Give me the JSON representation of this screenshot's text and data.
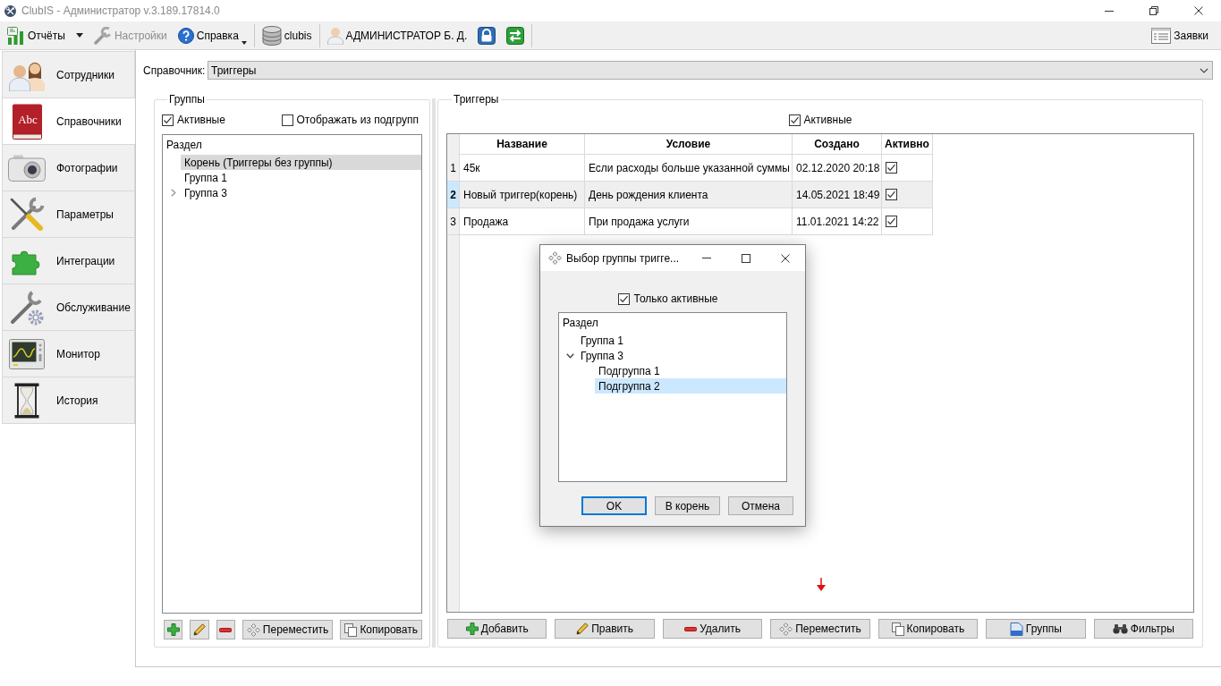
{
  "window": {
    "title": "ClubIS - Администратор v.3.189.17814.0"
  },
  "toolbar": {
    "groups": [
      [
        {
          "kind": "reports",
          "label": "Отчёты",
          "disabled": false
        },
        {
          "kind": "dropdown"
        },
        {
          "kind": "settings",
          "label": "Настройки",
          "disabled": true
        },
        {
          "kind": "help",
          "label": "Справка",
          "disabled": false
        }
      ],
      [
        {
          "kind": "database",
          "label": "clubis",
          "disabled": false
        }
      ],
      [
        {
          "kind": "user",
          "label": "АДМИНИСТРАТОР Б. Д.",
          "disabled": false
        },
        {
          "kind": "lock"
        },
        {
          "kind": "exit"
        }
      ]
    ],
    "requests": {
      "label": "Заявки"
    }
  },
  "sidebar": {
    "items": [
      {
        "label": "Сотрудники",
        "selected": false
      },
      {
        "label": "Справочники",
        "selected": true,
        "icon_text": "Abc"
      },
      {
        "label": "Фотографии",
        "selected": false
      },
      {
        "label": "Параметры",
        "selected": false
      },
      {
        "label": "Интеграции",
        "selected": false
      },
      {
        "label": "Обслуживание",
        "selected": false
      },
      {
        "label": "Монитор",
        "selected": false
      },
      {
        "label": "История",
        "selected": false
      }
    ]
  },
  "directory": {
    "label": "Справочник:",
    "value": "Триггеры"
  },
  "groups": {
    "title": "Группы",
    "active_only": {
      "label": "Активные",
      "checked": true
    },
    "show_subgroups": {
      "label": "Отображать из подгрупп",
      "checked": false
    },
    "tree": {
      "header": "Раздел",
      "items": [
        {
          "label": "Корень (Триггеры без группы)",
          "selected": true
        },
        {
          "label": "Группа 1",
          "selected": false
        },
        {
          "label": "Группа 3",
          "selected": false,
          "expanded": false
        }
      ]
    },
    "buttons": [
      {
        "kind": "add"
      },
      {
        "kind": "edit"
      },
      {
        "kind": "delete"
      },
      {
        "kind": "move",
        "label": "Переместить"
      },
      {
        "kind": "copy",
        "label": "Копировать"
      }
    ]
  },
  "triggers": {
    "title": "Триггеры",
    "active_only": {
      "label": "Активные",
      "checked": true
    },
    "table": {
      "columns": [
        "Название",
        "Условие",
        "Создано",
        "Активно"
      ],
      "rows": [
        {
          "number": "1",
          "name": "45к",
          "condition": "Если расходы больше указанной суммы",
          "created": "02.12.2020 20:18",
          "active": true,
          "selected": false
        },
        {
          "number": "2",
          "name": "Новый триггер(корень)",
          "condition": "День рождения клиента",
          "created": "14.05.2021 18:49",
          "active": true,
          "selected": true
        },
        {
          "number": "3",
          "name": "Продажа",
          "condition": "При продажа услуги",
          "created": "11.01.2021 14:22",
          "active": true,
          "selected": false
        }
      ]
    },
    "buttons": [
      {
        "kind": "add",
        "label": "Добавить"
      },
      {
        "kind": "edit",
        "label": "Править"
      },
      {
        "kind": "delete",
        "label": "Удалить"
      },
      {
        "kind": "move",
        "label": "Переместить"
      },
      {
        "kind": "copy",
        "label": "Копировать"
      },
      {
        "kind": "groups",
        "label": "Группы"
      },
      {
        "kind": "filters",
        "label": "Фильтры"
      }
    ]
  },
  "dialog": {
    "title": "Выбор группы тригге...",
    "only_active": {
      "label": "Только активные",
      "checked": true
    },
    "tree": {
      "header": "Раздел",
      "items": [
        {
          "label": "Группа 1",
          "selected": false
        },
        {
          "label": "Группа 3",
          "selected": false,
          "expanded": true,
          "children": [
            {
              "label": "Подгруппа 1",
              "selected": false
            },
            {
              "label": "Подгруппа 2",
              "selected": true
            }
          ]
        }
      ]
    },
    "buttons": [
      {
        "label": "OK",
        "focused": true
      },
      {
        "label": "В корень",
        "focused": false
      },
      {
        "label": "Отмена",
        "focused": false
      }
    ]
  }
}
